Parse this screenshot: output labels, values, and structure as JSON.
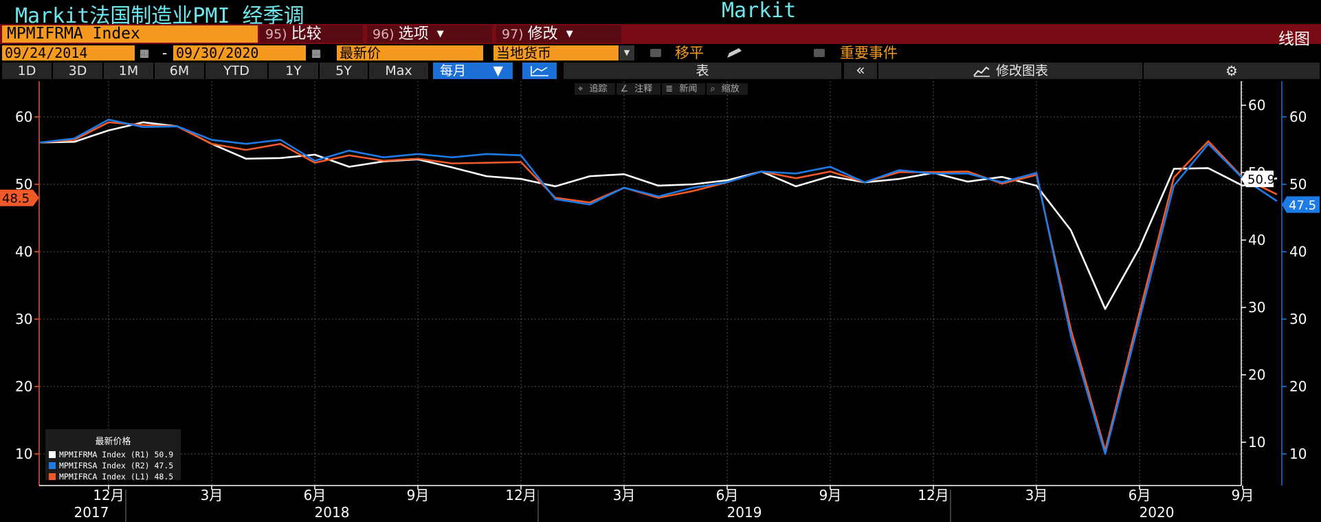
{
  "title": {
    "left": "Markit法国制造业PMI 经季调",
    "right": "Markit"
  },
  "security": "MPMIFRMA Index",
  "menu": [
    {
      "num": "95)",
      "label": "比较",
      "arrow": ""
    },
    {
      "num": "96)",
      "label": "选项",
      "arrow": "▼"
    },
    {
      "num": "97)",
      "label": "修改",
      "arrow": "▼"
    }
  ],
  "chart_link": "线图",
  "range": {
    "start": "09/24/2014",
    "sep": "-",
    "end": "09/30/2020"
  },
  "price_type": "最新价",
  "currency": "当地货币",
  "moving_avg": "移平",
  "events": "重要事件",
  "periods": [
    "1D",
    "3D",
    "1M",
    "6M",
    "YTD",
    "1Y",
    "5Y",
    "Max"
  ],
  "frequency": "每月",
  "table_label": "表",
  "edit_chart": "修改图表",
  "tools": [
    "追踪",
    "注释",
    "新闻",
    "缩放"
  ],
  "legend": {
    "title": "最新价格",
    "items": [
      {
        "label": "MPMIFRMA Index  (R1) 50.9",
        "color": "#ffffff"
      },
      {
        "label": "MPMIFRSA Index  (R2) 47.5",
        "color": "#1e7be6"
      },
      {
        "label": "MPMIFRCA Index  (L1) 48.5",
        "color": "#f05a28"
      }
    ]
  },
  "chart_data": {
    "type": "line",
    "x_start": "2017-10",
    "x_end": "2020-09",
    "x_ticks": [
      "12月",
      "3月",
      "6月",
      "9月",
      "12月",
      "3月",
      "6月",
      "9月",
      "12月",
      "3月",
      "6月",
      "9月"
    ],
    "years": [
      "2017",
      "2018",
      "2019",
      "2020"
    ],
    "left_axis": {
      "label": "L1",
      "ylim": [
        5,
        65
      ],
      "ticks": [
        10,
        20,
        30,
        40,
        50,
        60
      ]
    },
    "r1_axis": {
      "label": "R1",
      "ylim": [
        5,
        65
      ],
      "ticks": [
        10,
        20,
        30,
        40,
        50,
        60
      ]
    },
    "r2_axis": {
      "label": "R2",
      "ylim": [
        5,
        65
      ],
      "ticks": [
        10,
        20,
        30,
        40,
        50,
        60
      ]
    },
    "series": [
      {
        "name": "MPMIFRMA Index",
        "axis": "R1",
        "color": "#ffffff",
        "last": "50.9",
        "values": [
          56.2,
          56.3,
          58.0,
          59.2,
          58.6,
          56.0,
          53.8,
          53.9,
          54.4,
          52.6,
          53.4,
          53.7,
          52.5,
          51.2,
          50.8,
          49.7,
          51.2,
          51.5,
          49.8,
          50.0,
          50.6,
          51.9,
          49.7,
          51.2,
          50.3,
          50.8,
          51.7,
          50.4,
          51.1,
          49.8,
          43.2,
          31.5,
          40.6,
          52.3,
          52.4,
          49.8,
          50.9
        ]
      },
      {
        "name": "MPMIFRSA Index",
        "axis": "R2",
        "color": "#1e7be6",
        "last": "47.5",
        "values": [
          56.2,
          56.8,
          59.6,
          58.5,
          58.6,
          56.6,
          56.0,
          56.6,
          53.5,
          55.0,
          54.0,
          54.5,
          54.0,
          54.5,
          54.3,
          47.8,
          47.0,
          49.5,
          48.2,
          49.5,
          50.3,
          51.9,
          51.6,
          52.6,
          50.3,
          52.1,
          51.6,
          51.6,
          50.3,
          51.7,
          27.5,
          10.0,
          30.0,
          49.8,
          56.0,
          50.9,
          47.5
        ]
      },
      {
        "name": "MPMIFRCA Index",
        "axis": "L1",
        "color": "#f05a28",
        "last": "48.5",
        "values": [
          56.2,
          56.6,
          59.2,
          58.8,
          58.6,
          56.0,
          55.1,
          56.0,
          53.2,
          54.3,
          53.5,
          53.8,
          53.1,
          53.2,
          53.3,
          48.0,
          47.3,
          49.5,
          48.0,
          49.0,
          50.3,
          51.9,
          50.9,
          51.9,
          50.3,
          51.8,
          51.8,
          51.9,
          50.1,
          51.4,
          28.5,
          10.5,
          31.0,
          51.0,
          56.4,
          51.0,
          48.5
        ]
      }
    ]
  }
}
